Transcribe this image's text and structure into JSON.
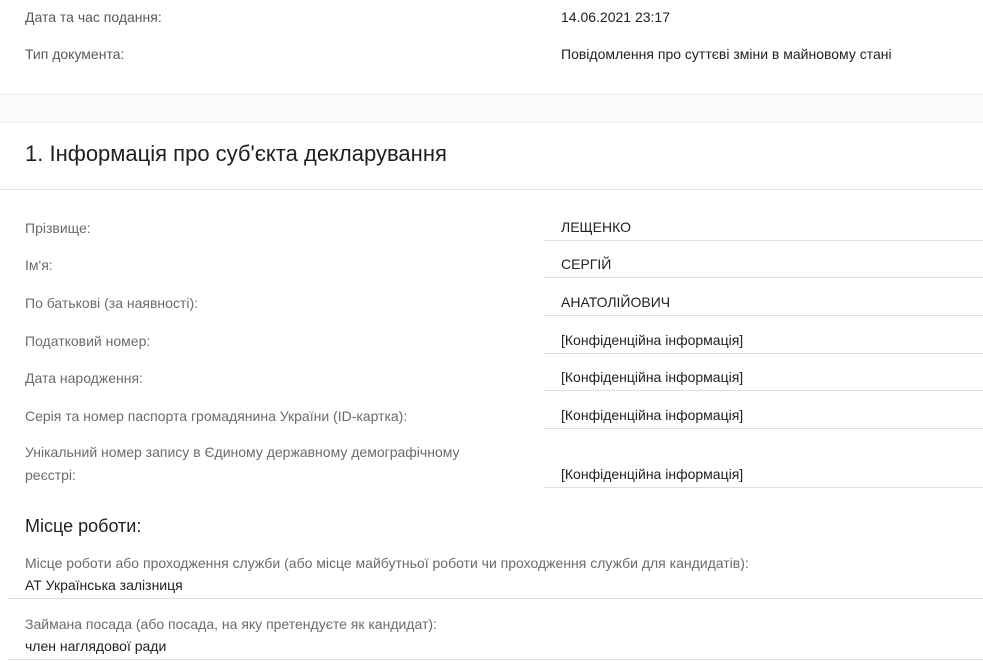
{
  "meta": {
    "submission_label": "Дата та час подання:",
    "submission_value": "14.06.2021 23:17",
    "doc_type_label": "Тип документа:",
    "doc_type_value": "Повідомлення про суттєві зміни в майновому стані"
  },
  "section": {
    "title": "1. Інформація про суб'єкта декларування"
  },
  "fields": [
    {
      "label": "Прізвище:",
      "value": "ЛЕЩЕНКО"
    },
    {
      "label": "Ім'я:",
      "value": "СЕРГІЙ"
    },
    {
      "label": "По батькові (за наявності):",
      "value": "АНАТОЛІЙОВИЧ"
    },
    {
      "label": "Податковий номер:",
      "value": "[Конфіденційна інформація]"
    },
    {
      "label": "Дата народження:",
      "value": "[Конфіденційна інформація]"
    },
    {
      "label": "Серія та номер паспорта громадянина України (ID-картка):",
      "value": "[Конфіденційна інформація]"
    },
    {
      "label": "Унікальний номер запису в Єдиному державному демографічному реєстрі:",
      "value": "[Конфіденційна інформація]"
    }
  ],
  "work": {
    "heading": "Місце роботи:",
    "place_label": "Місце роботи або проходження служби (або місце майбутньої роботи чи проходження служби для кандидатів):",
    "place_value": "АТ Українська залізниця",
    "position_label": "Займана посада (або посада, на яку претендуєте як кандидат):",
    "position_value": "член наглядової ради"
  }
}
